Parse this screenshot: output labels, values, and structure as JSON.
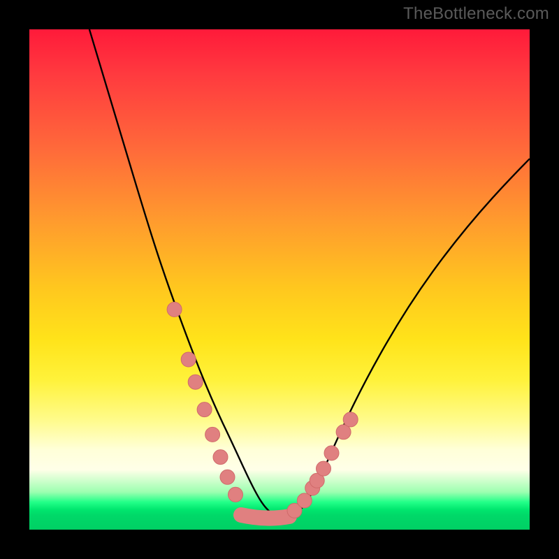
{
  "attribution": "TheBottleneck.com",
  "colors": {
    "background": "#000000",
    "curve": "#000000",
    "marker_fill": "#e08080",
    "marker_stroke": "#d06a6a",
    "gradient_top": "#ff1a3a",
    "gradient_bottom": "#00d064",
    "green_band": "#00e66e"
  },
  "chart_data": {
    "type": "line",
    "title": "",
    "xlabel": "",
    "ylabel": "",
    "xlim": [
      0,
      100
    ],
    "ylim": [
      0,
      100
    ],
    "series": [
      {
        "name": "bottleneck-curve",
        "x": [
          12,
          15,
          18,
          21,
          24,
          26.5,
          29,
          31,
          33,
          35,
          36.6,
          38.2,
          39.6,
          41,
          42.5,
          44,
          47,
          50,
          52,
          54.5,
          56.5,
          58.2,
          60,
          62.5,
          65,
          68,
          72,
          76,
          81,
          86,
          92,
          100
        ],
        "y": [
          100,
          90,
          80,
          70,
          60,
          52,
          44,
          37,
          30,
          24,
          19,
          14.5,
          10.5,
          7.5,
          5,
          3.5,
          2.3,
          2.2,
          2.9,
          5,
          8,
          11,
          14.5,
          19,
          23.5,
          28.5,
          34.5,
          40,
          46,
          51.5,
          57,
          63.5
        ]
      }
    ],
    "markers": {
      "left_branch": [
        {
          "x": 29.0,
          "y": 44.0
        },
        {
          "x": 31.8,
          "y": 34.0
        },
        {
          "x": 33.2,
          "y": 29.5
        },
        {
          "x": 35.0,
          "y": 24.0
        },
        {
          "x": 36.6,
          "y": 19.0
        },
        {
          "x": 38.2,
          "y": 14.5
        },
        {
          "x": 39.6,
          "y": 10.5
        },
        {
          "x": 41.2,
          "y": 7.0
        }
      ],
      "right_branch": [
        {
          "x": 53.0,
          "y": 3.8
        },
        {
          "x": 55.0,
          "y": 5.8
        },
        {
          "x": 56.6,
          "y": 8.3
        },
        {
          "x": 57.5,
          "y": 9.8
        },
        {
          "x": 58.8,
          "y": 12.2
        },
        {
          "x": 60.4,
          "y": 15.3
        },
        {
          "x": 62.8,
          "y": 19.5
        },
        {
          "x": 64.2,
          "y": 22.0
        }
      ],
      "trough": [
        {
          "x": 43.0,
          "y": 3.0
        },
        {
          "x": 45.0,
          "y": 2.4
        },
        {
          "x": 47.0,
          "y": 2.2
        },
        {
          "x": 49.0,
          "y": 2.2
        },
        {
          "x": 51.0,
          "y": 2.5
        }
      ]
    },
    "annotations": []
  }
}
